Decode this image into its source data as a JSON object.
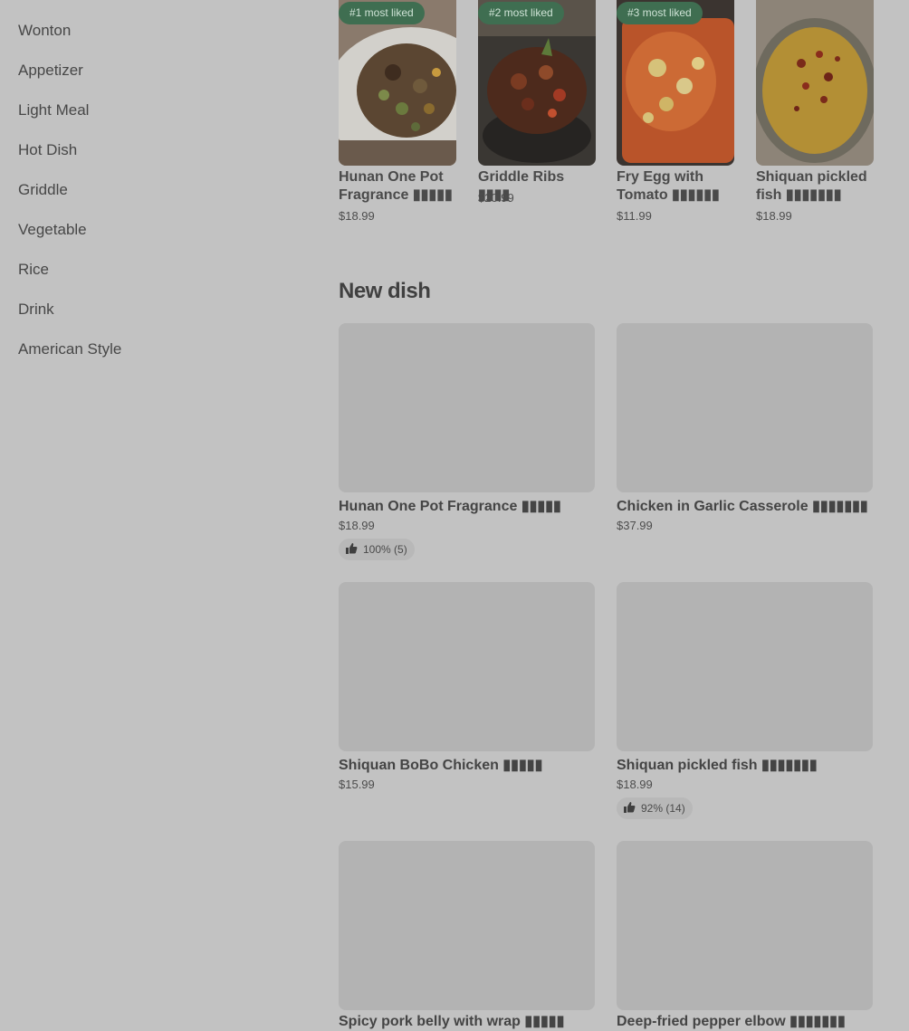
{
  "sidebar": {
    "items": [
      {
        "label": "Wonton"
      },
      {
        "label": "Appetizer"
      },
      {
        "label": "Light Meal"
      },
      {
        "label": "Hot Dish"
      },
      {
        "label": "Griddle"
      },
      {
        "label": "Vegetable"
      },
      {
        "label": "Rice"
      },
      {
        "label": "Drink"
      },
      {
        "label": "American Style"
      }
    ]
  },
  "most_liked": [
    {
      "badge": "#1 most liked",
      "name": "Hunan One Pot Fragrance ▮▮▮▮▮",
      "price": "$18.99",
      "icon": "dish-photo-stirfry"
    },
    {
      "badge": "#2 most liked",
      "name": "Griddle Ribs ▮▮▮▮",
      "price": "$20.99",
      "icon": "dish-photo-ribs"
    },
    {
      "badge": "#3 most liked",
      "name": "Fry Egg with Tomato ▮▮▮▮▮▮",
      "price": "$11.99",
      "icon": "dish-photo-egg-tomato"
    },
    {
      "badge": "",
      "name": "Shiquan pickled fish ▮▮▮▮▮▮▮",
      "price": "$18.99",
      "icon": "dish-photo-pickled-fish"
    }
  ],
  "new_dish": {
    "title": "New dish",
    "items": [
      {
        "name": "Hunan One Pot Fragrance ▮▮▮▮▮",
        "price": "$18.99",
        "rating": "100% (5)"
      },
      {
        "name": "Chicken in Garlic Casserole ▮▮▮▮▮▮▮",
        "price": "$37.99",
        "rating": ""
      },
      {
        "name": "Shiquan BoBo Chicken ▮▮▮▮▮",
        "price": "$15.99",
        "rating": ""
      },
      {
        "name": "Shiquan pickled fish ▮▮▮▮▮▮▮",
        "price": "$18.99",
        "rating": "92% (14)"
      },
      {
        "name": "Spicy pork belly with wrap ▮▮▮▮▮",
        "price": "",
        "rating": ""
      },
      {
        "name": "Deep-fried pepper elbow ▮▮▮▮▮▮▮",
        "price": "",
        "rating": ""
      }
    ]
  },
  "colors": {
    "overlay_bg": "#c2c2c2",
    "badge_bg": "#3f6e51",
    "placeholder": "#b3b3b3"
  }
}
